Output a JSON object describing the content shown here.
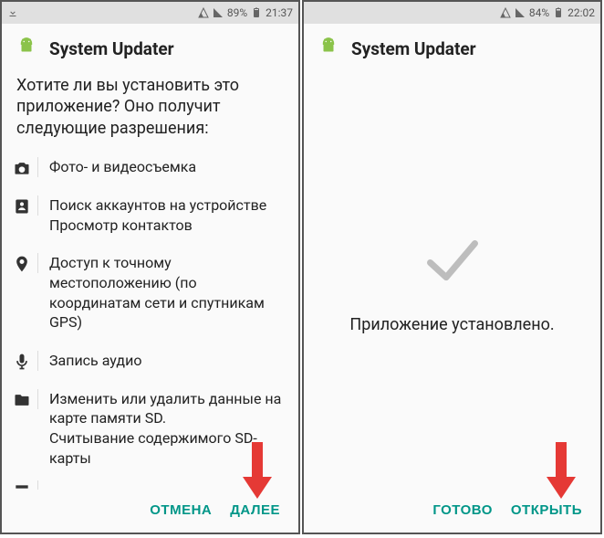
{
  "left": {
    "statusbar": {
      "battery_pct": "89%",
      "time": "21:37"
    },
    "app_title": "System Updater",
    "prompt": "Хотите ли вы установить это приложение? Оно получит следующие разрешения:",
    "permissions": [
      {
        "icon": "camera-icon",
        "lines": [
          "Фото- и видеосъемка"
        ]
      },
      {
        "icon": "contacts-icon",
        "lines": [
          "Поиск аккаунтов на устройстве",
          "Просмотр контактов"
        ]
      },
      {
        "icon": "location-icon",
        "lines": [
          "Доступ к точному местоположению (по координатам сети и спутникам GPS)"
        ]
      },
      {
        "icon": "mic-icon",
        "lines": [
          "Запись аудио"
        ]
      },
      {
        "icon": "folder-icon",
        "lines": [
          "Изменить или удалить данные на карте памяти SD.",
          "Считывание содержимого SD-карты"
        ]
      }
    ],
    "buttons": {
      "cancel": "ОТМЕНА",
      "next": "ДАЛЕЕ"
    }
  },
  "right": {
    "statusbar": {
      "battery_pct": "84%",
      "time": "22:02"
    },
    "app_title": "System Updater",
    "installed_msg": "Приложение установлено.",
    "buttons": {
      "done": "ГОТОВО",
      "open": "ОТКРЫТЬ"
    }
  }
}
